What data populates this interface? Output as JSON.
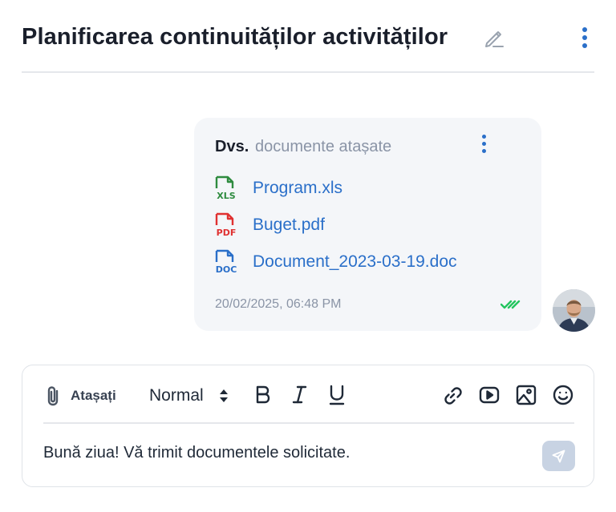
{
  "header": {
    "title": "Planificarea continuităților activităților"
  },
  "message": {
    "sender": "Dvs.",
    "action": "documente atașate",
    "attachments": [
      {
        "name": "Program.xls",
        "type": "XLS",
        "color": "#2e8b3f",
        "icon": "xls-file-icon"
      },
      {
        "name": "Buget.pdf",
        "type": "PDF",
        "color": "#e03131",
        "icon": "pdf-file-icon"
      },
      {
        "name": "Document_2023-03-19.doc",
        "type": "DOC",
        "color": "#2a6fc9",
        "icon": "doc-file-icon"
      }
    ],
    "timestamp": "20/02/2025, 06:48 PM",
    "read_color": "#22c55e"
  },
  "composer": {
    "attach_label": "Atașați",
    "format_value": "Normal",
    "text": "Bună ziua! Vă trimit documentele solicitate."
  },
  "colors": {
    "accent": "#2a6fc9",
    "send_button": "#c8d3e3"
  }
}
